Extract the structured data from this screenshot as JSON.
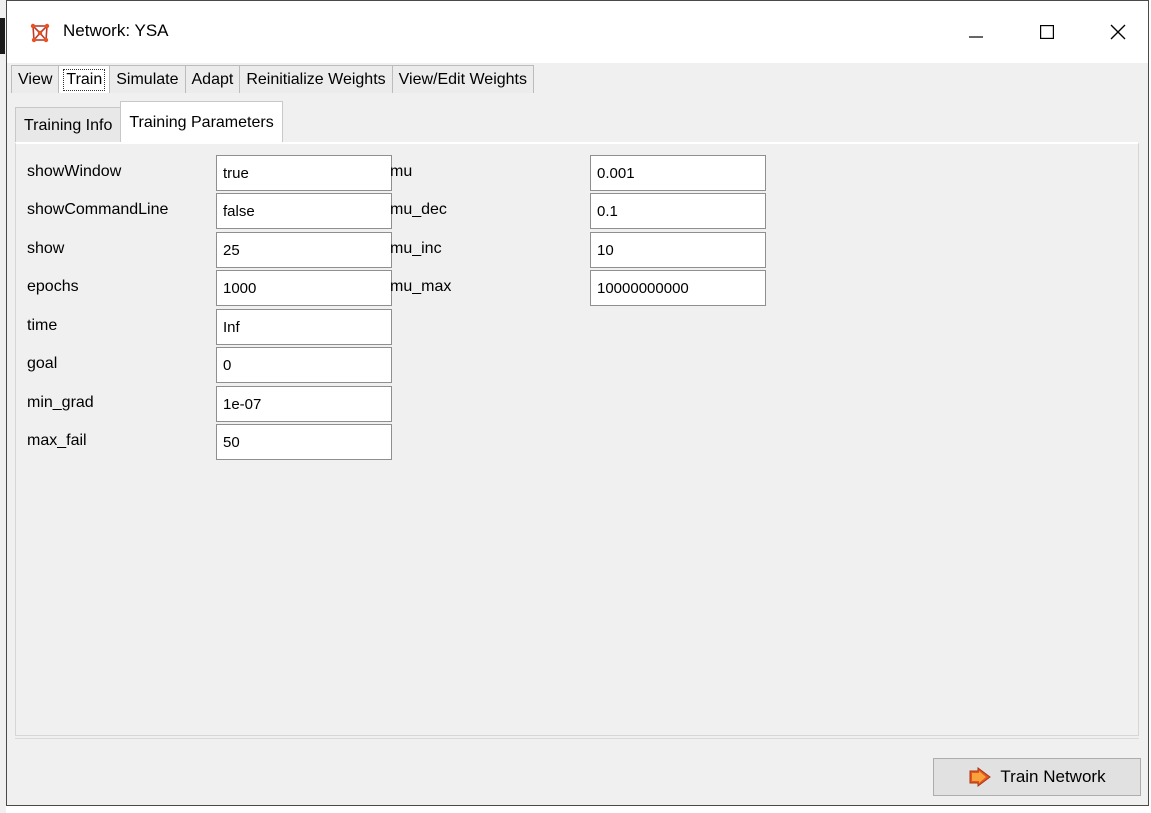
{
  "window": {
    "title": "Network: YSA",
    "minimize_label": "Minimize",
    "maximize_label": "Maximize",
    "close_label": "Close"
  },
  "menu_tabs": [
    {
      "label": "View"
    },
    {
      "label": "Train",
      "active": true
    },
    {
      "label": "Simulate"
    },
    {
      "label": "Adapt"
    },
    {
      "label": "Reinitialize Weights"
    },
    {
      "label": "View/Edit Weights"
    }
  ],
  "sub_tabs": [
    {
      "label": "Training Info"
    },
    {
      "label": "Training Parameters",
      "active": true
    }
  ],
  "params_left": [
    {
      "label": "showWindow",
      "value": "true"
    },
    {
      "label": "showCommandLine",
      "value": "false"
    },
    {
      "label": "show",
      "value": "25"
    },
    {
      "label": "epochs",
      "value": "1000"
    },
    {
      "label": "time",
      "value": "Inf"
    },
    {
      "label": "goal",
      "value": "0"
    },
    {
      "label": "min_grad",
      "value": "1e-07"
    },
    {
      "label": "max_fail",
      "value": "50"
    }
  ],
  "params_right": [
    {
      "label": "mu",
      "value": "0.001"
    },
    {
      "label": "mu_dec",
      "value": "0.1"
    },
    {
      "label": "mu_inc",
      "value": "10"
    },
    {
      "label": "mu_max",
      "value": "10000000000"
    }
  ],
  "actions": {
    "train_label": "Train Network"
  },
  "colors": {
    "window_bg": "#f0f0f0",
    "titlebar_bg": "#ffffff",
    "icon_accent": "#e8531f"
  },
  "icons": {
    "app": "network-app-icon",
    "train": "train-arrow-icon"
  }
}
